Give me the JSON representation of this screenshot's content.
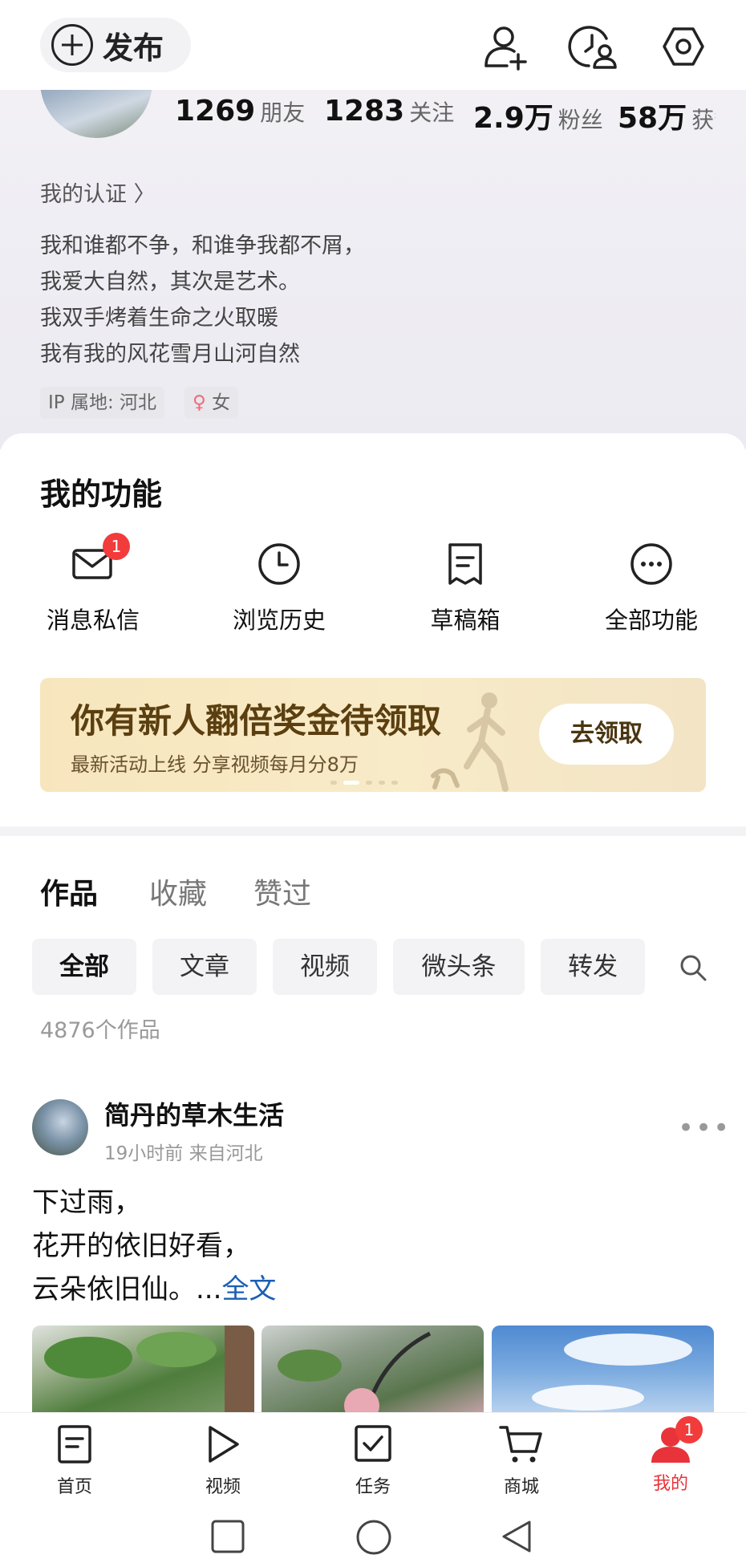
{
  "topbar": {
    "publish_label": "发布",
    "add_friend_icon": "add-user-icon",
    "visitor_icon": "visitor-history-icon",
    "settings_icon": "settings-icon"
  },
  "profile": {
    "stats": [
      {
        "value": "1269",
        "label": "朋友"
      },
      {
        "value": "1283",
        "label": "关注"
      },
      {
        "value": "2.9万",
        "label": "粉丝"
      },
      {
        "value": "58万",
        "label": "获赞"
      }
    ],
    "certification": "我的认证 〉",
    "bio_lines": [
      "我和谁都不争，和谁争我都不屑，",
      "我爱大自然，其次是艺术。",
      "我双手烤着生命之火取暖",
      "我有我的风花雪月山河自然"
    ],
    "ip_tag": "IP 属地: 河北",
    "gender_symbol": "♀",
    "gender_tag": "女"
  },
  "features": {
    "title": "我的功能",
    "items": [
      {
        "label": "消息私信",
        "icon": "message-icon",
        "badge": "1"
      },
      {
        "label": "浏览历史",
        "icon": "clock-icon"
      },
      {
        "label": "草稿箱",
        "icon": "draft-icon"
      },
      {
        "label": "全部功能",
        "icon": "more-icon"
      }
    ]
  },
  "banner": {
    "title": "你有新人翻倍奖金待领取",
    "subtitle": "最新活动上线 分享视频每月分8万",
    "cta": "去领取"
  },
  "content_tabs": [
    "作品",
    "收藏",
    "赞过"
  ],
  "filters": [
    "全部",
    "文章",
    "视频",
    "微头条",
    "转发"
  ],
  "works_count": "4876个作品",
  "post": {
    "author": "简丹的草木生活",
    "meta": "19小时前 来自河北",
    "lines": [
      "下过雨，",
      "花开的依旧好看，",
      "云朵依旧仙。..."
    ],
    "more_link": "全文"
  },
  "bottom_nav": [
    {
      "label": "首页",
      "icon": "home-icon"
    },
    {
      "label": "视频",
      "icon": "video-icon"
    },
    {
      "label": "任务",
      "icon": "task-icon"
    },
    {
      "label": "商城",
      "icon": "cart-icon"
    },
    {
      "label": "我的",
      "icon": "profile-icon",
      "badge": "1"
    }
  ],
  "colors": {
    "accent_red": "#e8333a",
    "link_blue": "#1a5fb4"
  }
}
